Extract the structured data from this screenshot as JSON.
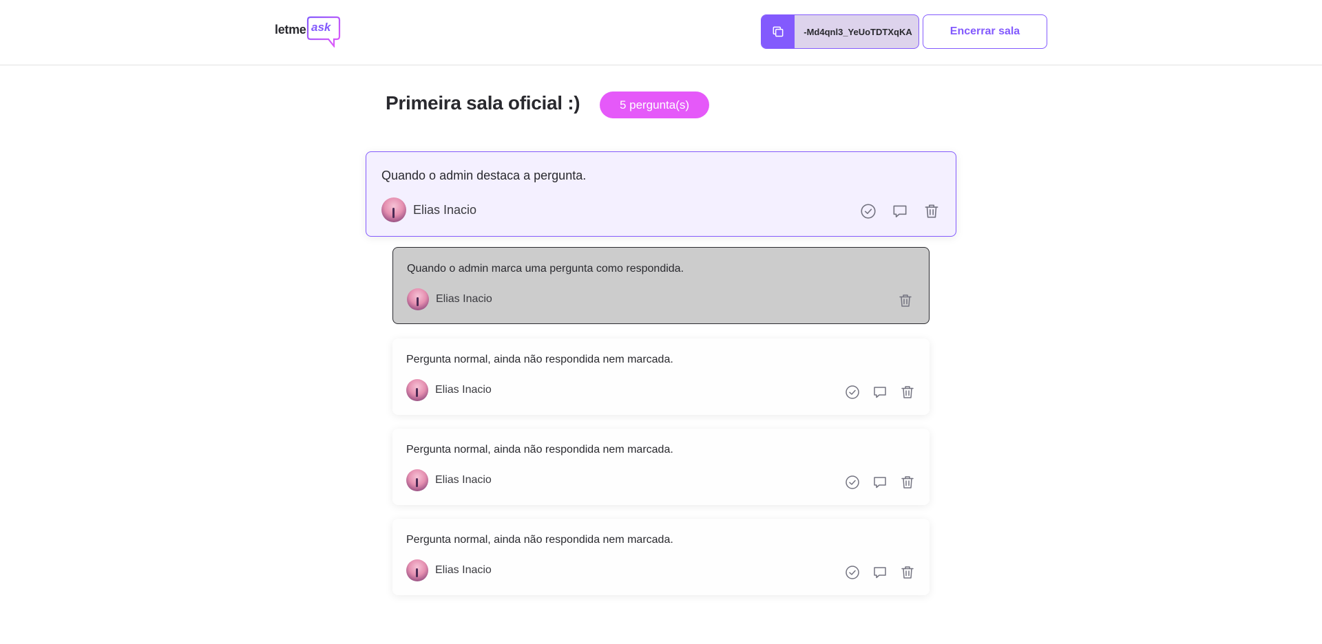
{
  "header": {
    "logo": {
      "text_left": "letme",
      "text_right": "ask"
    },
    "room_code": {
      "icon": "copy-icon",
      "code": "-Md4qnl3_YeUoTDTXqKA"
    },
    "close_button": "Encerrar sala"
  },
  "room": {
    "title": "Primeira sala oficial :)",
    "question_count": "5 pergunta(s)"
  },
  "questions": [
    {
      "state": "highlighted",
      "content": "Quando o admin destaca a pergunta.",
      "author": "Elias Inacio",
      "actions": [
        "check-circle-icon",
        "answer-icon",
        "delete-icon"
      ]
    },
    {
      "state": "answered",
      "content": "Quando o admin marca uma pergunta como respondida.",
      "author": "Elias Inacio",
      "actions": [
        "delete-icon"
      ]
    },
    {
      "state": "normal",
      "content": "Pergunta normal, ainda não respondida nem marcada.",
      "author": "Elias Inacio",
      "actions": [
        "check-circle-icon",
        "answer-icon",
        "delete-icon"
      ]
    },
    {
      "state": "normal",
      "content": "Pergunta normal, ainda não respondida nem marcada.",
      "author": "Elias Inacio",
      "actions": [
        "check-circle-icon",
        "answer-icon",
        "delete-icon"
      ]
    },
    {
      "state": "normal",
      "content": "Pergunta normal, ainda não respondida nem marcada.",
      "author": "Elias Inacio",
      "actions": [
        "check-circle-icon",
        "answer-icon",
        "delete-icon"
      ]
    }
  ],
  "colors": {
    "accent": "#835afd",
    "badge": "#e559f9",
    "answered_bg": "#cccccc",
    "highlight_bg": "#f4f0ff"
  }
}
